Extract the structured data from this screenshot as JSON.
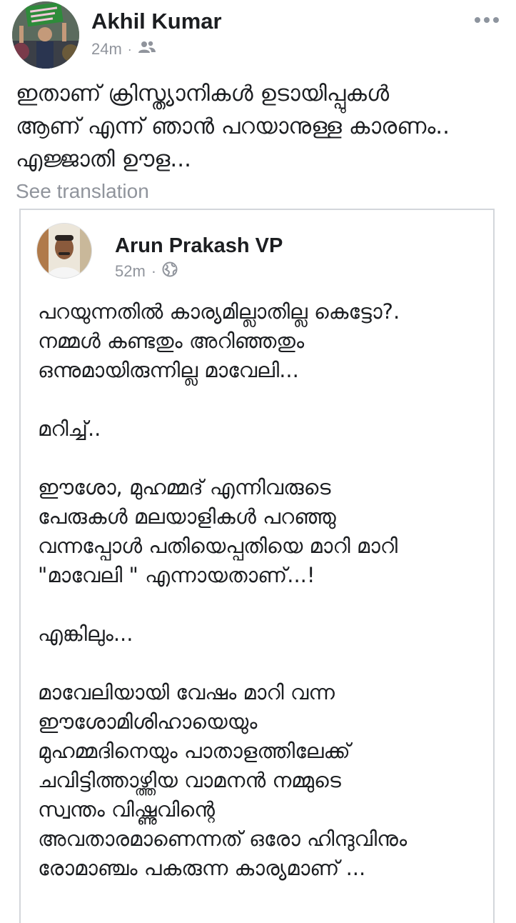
{
  "post": {
    "author": "Akhil Kumar",
    "time": "24m",
    "separator": "·",
    "audience_icon": "friends-icon",
    "text": "ഇതാണ് ക്രിസ്ത്യാനികൾ ഉടായിപ്പുകൾ\nആണ് എന്ന് ഞാൻ പറയാനുള്ള കാരണം..\nഎജ്ജാതി ഊള...",
    "see_translation": "See translation",
    "more_icon": "more-options-icon",
    "avatar_badge_color": "#2e8b3a"
  },
  "shared": {
    "author": "Arun Prakash VP",
    "time": "52m",
    "separator": "·",
    "audience_icon": "globe-icon",
    "text": "പറയുന്നതിൽ കാര്യമില്ലാതില്ല കെട്ടോ?.\nനമ്മൾ കണ്ടതും അറിഞ്ഞതും\nഒന്നുമായിരുന്നില്ല മാവേലി...\n\nമറിച്ച്..\n\nഈശോ, മുഹമ്മദ് എന്നിവരുടെ\nപേരുകൾ മലയാളികൾ പറഞ്ഞു\nവന്നപ്പോൾ പതിയെപ്പതിയെ മാറി മാറി\n\"മാവേലി \" എന്നായതാണ്...!\n\nഎങ്കിലും...\n\nമാവേലിയായി വേഷം മാറി വന്ന\nഈശോമിശിഹായെയും\nമുഹമ്മദിനെയും പാതാളത്തിലേക്ക്\nചവിട്ടിത്താഴ്ത്തിയ വാമനൻ നമ്മുടെ\nസ്വന്തം വിഷ്ണുവിന്റെ\nഅവതാരമാണെന്നത് ഒരോ ഹിന്ദുവിനും\nരോമാഞ്ചം പകരുന്ന കാര്യമാണ് ..."
  }
}
